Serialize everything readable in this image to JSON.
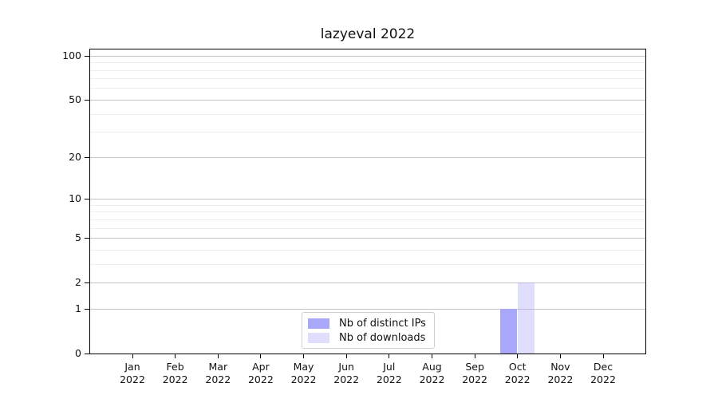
{
  "chart_data": {
    "type": "bar",
    "title": "lazyeval 2022",
    "categories": [
      "Jan 2022",
      "Feb 2022",
      "Mar 2022",
      "Apr 2022",
      "May 2022",
      "Jun 2022",
      "Jul 2022",
      "Aug 2022",
      "Sep 2022",
      "Oct 2022",
      "Nov 2022",
      "Dec 2022"
    ],
    "series": [
      {
        "name": "Nb of distinct IPs",
        "color": "#a9a8f8",
        "values": [
          0,
          0,
          0,
          0,
          0,
          0,
          0,
          0,
          0,
          1,
          0,
          0
        ]
      },
      {
        "name": "Nb of downloads",
        "color": "rgba(172,170,250,0.38)",
        "values": [
          0,
          0,
          0,
          0,
          0,
          0,
          0,
          0,
          0,
          2,
          0,
          0
        ]
      }
    ],
    "yscale": "log1p",
    "ylim": [
      0,
      110
    ],
    "y_major_ticks": [
      0,
      1,
      2,
      5,
      10,
      20,
      50,
      100
    ],
    "y_minor_ticks": [
      3,
      4,
      6,
      7,
      8,
      9,
      30,
      40,
      60,
      70,
      80,
      90
    ],
    "grid": "horizontal",
    "legend_position": "bottom-center-inside",
    "colors": {
      "axis": "#000000",
      "grid_major": "#c3c3c3",
      "grid_minor": "#ececec"
    }
  }
}
